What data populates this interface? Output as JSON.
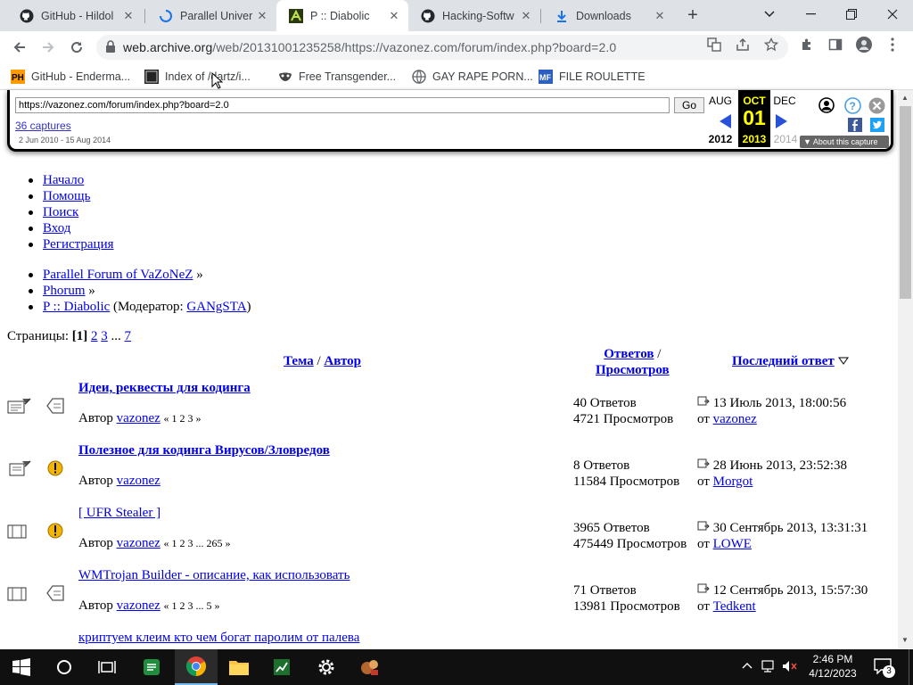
{
  "tabs": [
    {
      "title": "GitHub - Hildol",
      "icon": "github-icon"
    },
    {
      "title": "Parallel Univer",
      "icon": "loading-icon"
    },
    {
      "title": "P :: Diabolic",
      "icon": "diabolic-favicon"
    },
    {
      "title": "Hacking-Softw",
      "icon": "github-icon"
    },
    {
      "title": "Downloads",
      "icon": "download-icon"
    }
  ],
  "toolbar": {
    "url_host": "web.archive.org",
    "url_path": "/web/20131001235258/https://vazonez.com/forum/index.php?board=2.0"
  },
  "bookmarks": [
    {
      "label": "GitHub - Enderma...",
      "icon": "ph-icon"
    },
    {
      "label": "Index of /dartz/i...",
      "icon": "index-icon"
    },
    {
      "label": "Free Transgender...",
      "icon": "mask-icon"
    },
    {
      "label": "GAY RAPE PORN...",
      "icon": "globe-icon"
    },
    {
      "label": "FILE ROULETTE",
      "icon": "mf-icon"
    }
  ],
  "wayback": {
    "url": "https://vazonez.com/forum/index.php?board=2.0",
    "go": "Go",
    "captures": "36 captures",
    "range": "2 Jun 2010 - 15 Aug 2014",
    "prev_month": "AUG",
    "cur_month": "OCT",
    "next_month": "DEC",
    "day": "01",
    "prev_year": "2012",
    "cur_year": "2013",
    "next_year": "2014",
    "about": "About this capture"
  },
  "menu": [
    "Начало",
    "Помощь",
    "Поиск",
    "Вход",
    "Регистрация"
  ],
  "breadcrumbs": {
    "forum": "Parallel Forum of VaZoNeZ",
    "sep": "»",
    "section": "Phorum",
    "board": "P :: Diabolic",
    "moderator_prefix": "(Модератор:",
    "moderator": "GANgSTA",
    "moderator_suffix": ")"
  },
  "pagination": {
    "label": "Страницы:",
    "current": "[1]",
    "pages": [
      "2",
      "3"
    ],
    "ellipsis": "...",
    "last": "7"
  },
  "table_header": {
    "topic": "Тема",
    "slash": "/",
    "author": "Автор",
    "replies": "Ответов",
    "views": "Просмотров",
    "last_post": "Последний ответ"
  },
  "topics": [
    {
      "title": "Идеи, реквесты для кодинга",
      "bold": true,
      "author_label": "Автор",
      "author": "vazonez",
      "pages": "« 1 2 3 »",
      "replies": "40 Ответов",
      "views": "4721 Просмотров",
      "last_date": "13 Июль 2013, 18:00:56",
      "last_by_label": "от",
      "last_by": "vazonez"
    },
    {
      "title": "Полезное для кодинга Вирусов/Зловредов",
      "bold": true,
      "author_label": "Автор",
      "author": "vazonez",
      "pages": "",
      "replies": "8 Ответов",
      "views": "11584 Просмотров",
      "last_date": "28 Июнь 2013, 23:52:38",
      "last_by_label": "от",
      "last_by": "Morgot"
    },
    {
      "title": "[ UFR Stealer ]",
      "bold": false,
      "author_label": "Автор",
      "author": "vazonez",
      "pages": "« 1 2 3 ... 265 »",
      "replies": "3965 Ответов",
      "views": "475449 Просмотров",
      "last_date": "30 Сентябрь 2013, 13:31:31",
      "last_by_label": "от",
      "last_by": "LOWE"
    },
    {
      "title": "WMTrojan Builder - описание, как использовать",
      "bold": false,
      "author_label": "Автор",
      "author": "vazonez",
      "pages": "« 1 2 3 ... 5 »",
      "replies": "71 Ответов",
      "views": "13981 Просмотров",
      "last_date": "12 Сентябрь 2013, 15:57:30",
      "last_by_label": "от",
      "last_by": "Tedkent"
    },
    {
      "title": "криптуем клеим кто чем богат паролим от палева",
      "bold": false,
      "author_label": "",
      "author": "",
      "pages": "",
      "replies": "",
      "views": "",
      "last_date": "",
      "last_by_label": "",
      "last_by": ""
    }
  ],
  "taskbar": {
    "time": "2:46 PM",
    "date": "4/12/2023",
    "notifications": "3"
  },
  "colors": {
    "link": "#0000ee",
    "wayback_day": "#ffff00",
    "tab_bg": "#dee1e6"
  }
}
